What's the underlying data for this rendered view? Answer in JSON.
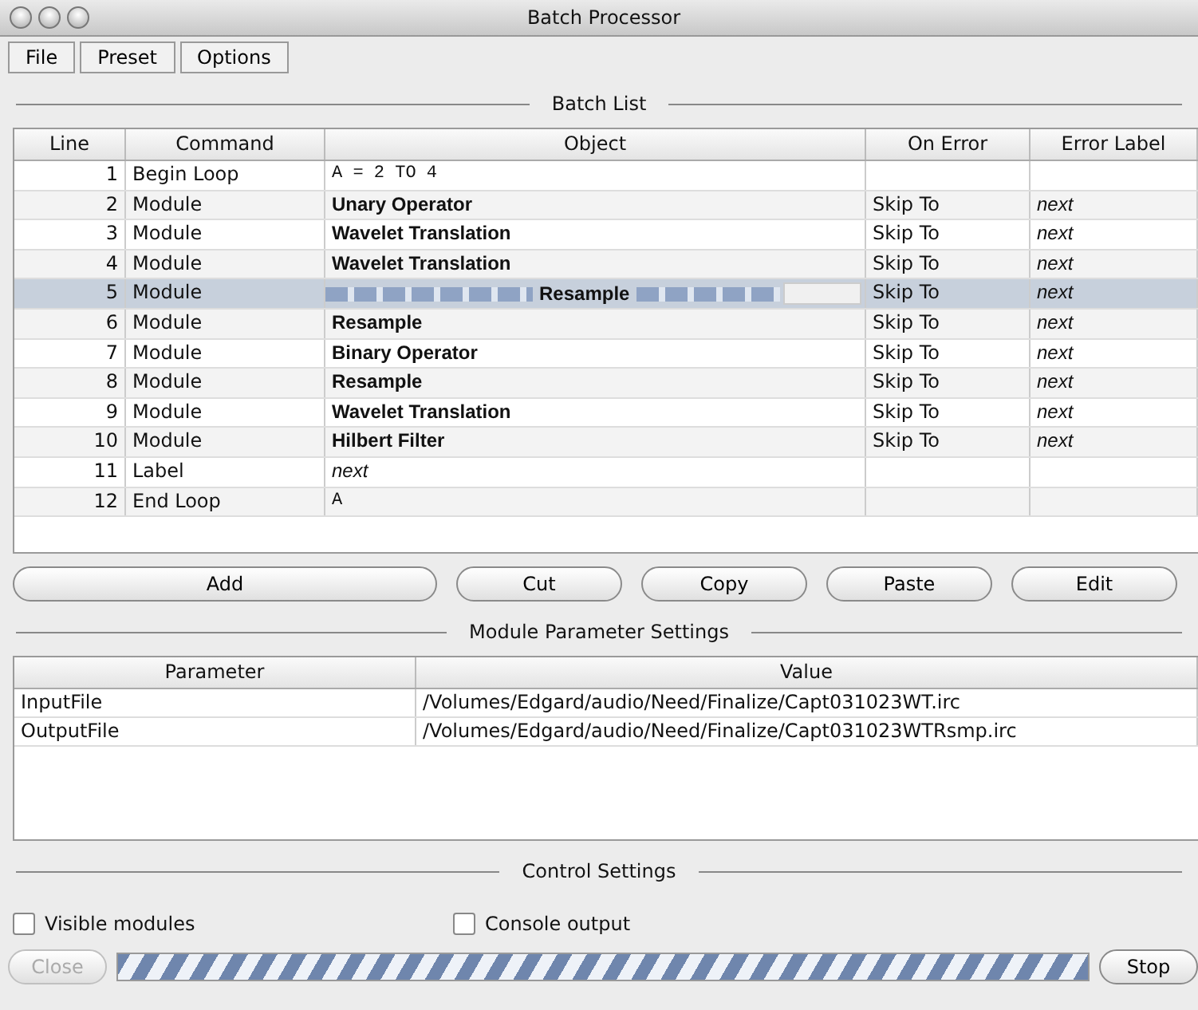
{
  "window": {
    "title": "Batch Processor"
  },
  "menu": [
    "File",
    "Preset",
    "Options"
  ],
  "batch_list": {
    "title": "Batch List",
    "columns": [
      "Line",
      "Command",
      "Object",
      "On Error",
      "Error Label"
    ],
    "rows": [
      {
        "line": "1",
        "command": "Begin Loop",
        "object": "A = 2 TO 4",
        "kind": "code",
        "running": false,
        "on_error": "",
        "error_label": "",
        "selected": false
      },
      {
        "line": "2",
        "command": "Module",
        "object": "Unary Operator",
        "kind": "module",
        "running": false,
        "on_error": "Skip To",
        "error_label": "next",
        "selected": false
      },
      {
        "line": "3",
        "command": "Module",
        "object": "Wavelet Translation",
        "kind": "module",
        "running": false,
        "on_error": "Skip To",
        "error_label": "next",
        "selected": false
      },
      {
        "line": "4",
        "command": "Module",
        "object": "Wavelet Translation",
        "kind": "module",
        "running": false,
        "on_error": "Skip To",
        "error_label": "next",
        "selected": false
      },
      {
        "line": "5",
        "command": "Module",
        "object": "Resample",
        "kind": "module",
        "running": true,
        "on_error": "Skip To",
        "error_label": "next",
        "selected": true
      },
      {
        "line": "6",
        "command": "Module",
        "object": "Resample",
        "kind": "module",
        "running": false,
        "on_error": "Skip To",
        "error_label": "next",
        "selected": false
      },
      {
        "line": "7",
        "command": "Module",
        "object": "Binary Operator",
        "kind": "module",
        "running": false,
        "on_error": "Skip To",
        "error_label": "next",
        "selected": false
      },
      {
        "line": "8",
        "command": "Module",
        "object": "Resample",
        "kind": "module",
        "running": false,
        "on_error": "Skip To",
        "error_label": "next",
        "selected": false
      },
      {
        "line": "9",
        "command": "Module",
        "object": "Wavelet Translation",
        "kind": "module",
        "running": false,
        "on_error": "Skip To",
        "error_label": "next",
        "selected": false
      },
      {
        "line": "10",
        "command": "Module",
        "object": "Hilbert Filter",
        "kind": "module",
        "running": false,
        "on_error": "Skip To",
        "error_label": "next",
        "selected": false
      },
      {
        "line": "11",
        "command": "Label",
        "object": "next",
        "kind": "label",
        "running": false,
        "on_error": "",
        "error_label": "",
        "selected": false
      },
      {
        "line": "12",
        "command": "End Loop",
        "object": "A",
        "kind": "code",
        "running": false,
        "on_error": "",
        "error_label": "",
        "selected": false
      }
    ]
  },
  "list_buttons": [
    "Add",
    "Cut",
    "Copy",
    "Paste",
    "Edit"
  ],
  "module_parameters": {
    "title": "Module Parameter Settings",
    "columns": [
      "Parameter",
      "Value"
    ],
    "rows": [
      {
        "parameter": "InputFile",
        "value": "/Volumes/Edgard/audio/Need/Finalize/Capt031023WT.irc"
      },
      {
        "parameter": "OutputFile",
        "value": "/Volumes/Edgard/audio/Need/Finalize/Capt031023WTRsmp.irc"
      }
    ]
  },
  "control_settings": {
    "title": "Control Settings",
    "options": [
      {
        "label": "Visible modules",
        "checked": false
      },
      {
        "label": "Console output",
        "checked": false
      }
    ]
  },
  "close_button": {
    "label": "Close",
    "disabled": true
  },
  "progress": {
    "level": 1
  },
  "stop_button": {
    "label": "Stop",
    "disabled": false
  }
}
